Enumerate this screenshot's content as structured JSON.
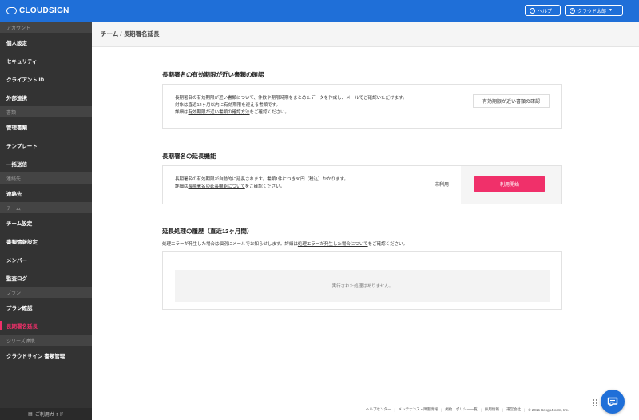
{
  "brand": {
    "name": "CLOUDSIGN"
  },
  "header": {
    "help_label": "ヘルプ",
    "user_label": "クラウド太郎"
  },
  "sidebar": {
    "sections": [
      {
        "heading": "アカウント",
        "items": [
          {
            "label": "個人設定"
          },
          {
            "label": "セキュリティ"
          },
          {
            "label": "クライアント ID"
          },
          {
            "label": "外部連携"
          }
        ]
      },
      {
        "heading": "書類",
        "items": [
          {
            "label": "管理書類"
          },
          {
            "label": "テンプレート"
          },
          {
            "label": "一括送信"
          }
        ]
      },
      {
        "heading": "連絡先",
        "items": [
          {
            "label": "連絡先"
          }
        ]
      },
      {
        "heading": "チーム",
        "items": [
          {
            "label": "チーム設定"
          },
          {
            "label": "書類情報設定"
          },
          {
            "label": "メンバー"
          },
          {
            "label": "監査ログ"
          }
        ]
      },
      {
        "heading": "プラン",
        "items": [
          {
            "label": "プラン確認"
          },
          {
            "label": "長期署名延長"
          }
        ]
      },
      {
        "heading": "シリーズ連携",
        "items": [
          {
            "label": "クラウドサイン 書類管理"
          }
        ]
      }
    ],
    "active_item": "長期署名延長",
    "guide_label": "ご利用ガイド"
  },
  "page": {
    "breadcrumb": "チーム / 長期署名延長"
  },
  "expiry_section": {
    "title": "長期署名の有効期限が近い書類の確認",
    "line1": "長期署名の有効期限が近い書類について、件数や期限時期をまとめたデータを作成し、メールでご確認いただけます。",
    "line2": "対象は直近12ヶ月以内に有効期限を迎える書類です。",
    "line3_prefix": "詳細は",
    "line3_link": "有効期限が近い書類の確認方法",
    "line3_suffix": "をご確認ください。",
    "button_label": "有効期限が近い書類の確認"
  },
  "extension_section": {
    "title": "長期署名の延長機能",
    "line1": "長期署名の有効期限が自動的に延長されます。書類1件につき30円（税込）かかります。",
    "line2_prefix": "詳細は",
    "line2_link": "長期署名の延長機能について",
    "line2_suffix": "をご確認ください。",
    "status": "未利用",
    "button_label": "利用開始"
  },
  "history_section": {
    "title": "延長処理の履歴（直近12ヶ月間）",
    "note_prefix": "処理エラーが発生した場合は個別にメールでお知らせします。詳細は",
    "note_link": "処理エラーが発生した場合について",
    "note_suffix": "をご確認ください。",
    "empty_message": "実行された処理はありません。"
  },
  "footer": {
    "links": [
      "ヘルプセンター",
      "メンテナンス・障害情報",
      "規約・ポリシー一覧",
      "採用情報",
      "運営会社"
    ],
    "copyright": "© 2015 Bengo4.com, Inc."
  },
  "colors": {
    "brand_blue": "#1f6fd8",
    "accent_pink": "#f0306a",
    "sidebar_bg": "#333333"
  }
}
